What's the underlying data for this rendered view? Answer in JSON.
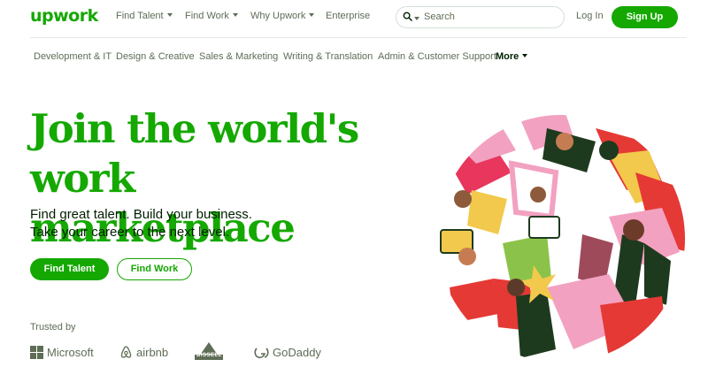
{
  "header": {
    "logo": "upwork",
    "nav": [
      {
        "label": "Find Talent",
        "has_caret": true
      },
      {
        "label": "Find Work",
        "has_caret": true
      },
      {
        "label": "Why Upwork",
        "has_caret": true
      },
      {
        "label": "Enterprise",
        "has_caret": false
      }
    ],
    "search": {
      "placeholder": "Search",
      "icon": "search-icon"
    },
    "login_label": "Log In",
    "signup_label": "Sign Up"
  },
  "categories": [
    "Development & IT",
    "Design & Creative",
    "Sales & Marketing",
    "Writing & Translation",
    "Admin & Customer Support"
  ],
  "more_label": "More",
  "hero": {
    "title_line1": "Join the world's",
    "title_line2": "work marketplace",
    "subtitle_line1": "Find great talent. Build your business.",
    "subtitle_line2": "Take your career to the next level.",
    "primary_cta": "Find Talent",
    "secondary_cta": "Find Work"
  },
  "trusted": {
    "label": "Trusted by",
    "brands": [
      {
        "name": "Microsoft",
        "icon": "microsoft-logo-icon"
      },
      {
        "name": "airbnb",
        "icon": "airbnb-logo-icon"
      },
      {
        "name": "BISSELL",
        "icon": "bissell-logo-icon"
      },
      {
        "name": "GoDaddy",
        "icon": "godaddy-logo-icon"
      }
    ]
  },
  "colors": {
    "brand_green": "#14a800",
    "text_dark": "#001e00",
    "text_muted": "#5e6d55",
    "border": "#d5e0d5"
  }
}
